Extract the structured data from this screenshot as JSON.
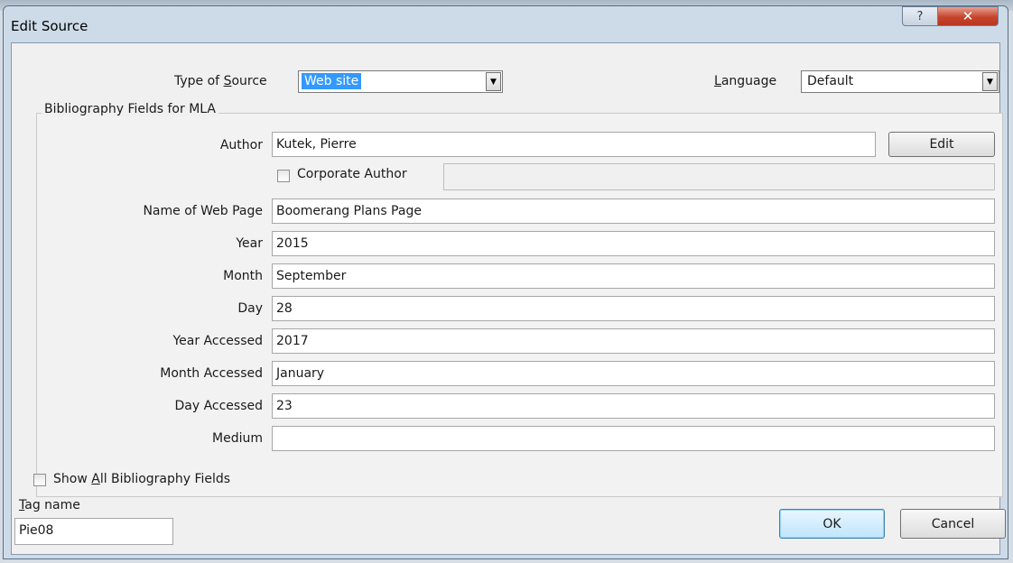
{
  "window": {
    "title": "Edit Source",
    "help_glyph": "?",
    "close_glyph": "✕"
  },
  "type_of_source": {
    "label_pre": "Type of ",
    "label_key": "S",
    "label_post": "ource",
    "value": "Web site"
  },
  "language": {
    "label_key": "L",
    "label_post": "anguage",
    "value": "Default"
  },
  "bibliography": {
    "group_label": "Bibliography Fields for MLA",
    "author": {
      "label": "Author",
      "value": "Kutek, Pierre"
    },
    "edit_button": "Edit",
    "corporate_author": {
      "label": "Corporate Author",
      "value": "",
      "checked": false
    },
    "fields": [
      {
        "label": "Name of Web Page",
        "value": "Boomerang Plans Page"
      },
      {
        "label": "Year",
        "value": "2015"
      },
      {
        "label": "Month",
        "value": "September"
      },
      {
        "label": "Day",
        "value": "28"
      },
      {
        "label": "Year Accessed",
        "value": "2017"
      },
      {
        "label": "Month Accessed",
        "value": "January"
      },
      {
        "label": "Day Accessed",
        "value": "23"
      },
      {
        "label": "Medium",
        "value": ""
      }
    ]
  },
  "show_all": {
    "label_pre": "Show ",
    "label_key": "A",
    "label_post": "ll Bibliography Fields",
    "checked": false
  },
  "tag": {
    "label_key": "T",
    "label_post": "ag name",
    "value": "Pie08"
  },
  "buttons": {
    "ok": "OK",
    "cancel": "Cancel"
  }
}
